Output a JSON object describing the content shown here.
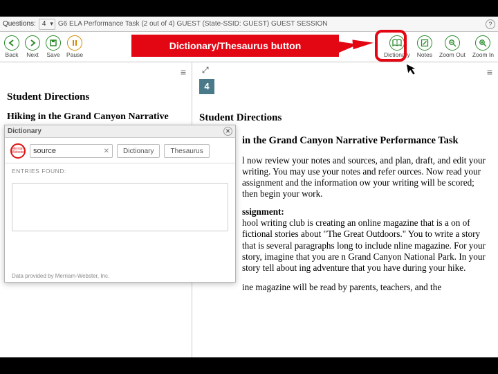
{
  "topbar": {
    "questions_label": "Questions:",
    "question_number": "4",
    "crumb": "G6 ELA Performance Task (2 out of 4)   GUEST (State-SSID: GUEST)   GUEST SESSION"
  },
  "toolbar": {
    "back": "Back",
    "next": "Next",
    "save": "Save",
    "pause": "Pause",
    "dictionary": "Dictionary",
    "notes": "Notes",
    "zoom_out": "Zoom Out",
    "zoom_in": "Zoom In"
  },
  "callout": {
    "text": "Dictionary/Thesaurus button"
  },
  "left": {
    "student_directions": "Student Directions",
    "task_title": "Hiking in the Grand Canyon Narrative"
  },
  "right": {
    "qnum": "4",
    "student_directions": "Student Directions",
    "task_title": "in the Grand Canyon Narrative Performance Task",
    "para1": "l now review your notes and sources, and plan, draft, and edit your writing. You may use your notes and refer ources. Now read your assignment and the information ow your writing will be scored; then begin your work.",
    "assign_label": "ssignment:",
    "para2": "hool writing club is creating an online magazine that is a on of fictional stories about \"The Great Outdoors.\" You to write a story that is several paragraphs long to include nline magazine. For your story, imagine that you are n Grand Canyon National Park. In your story tell about ing adventure that you have during your hike.",
    "para3": "ine magazine will be read by parents, teachers, and the"
  },
  "dialog": {
    "title": "Dictionary",
    "mw": "Merriam Webster",
    "search_value": "source",
    "btn_dict": "Dictionary",
    "btn_thes": "Thesaurus",
    "entries": "ENTRIES FOUND:",
    "credit": "Data provided by Merriam-Webster, Inc."
  }
}
